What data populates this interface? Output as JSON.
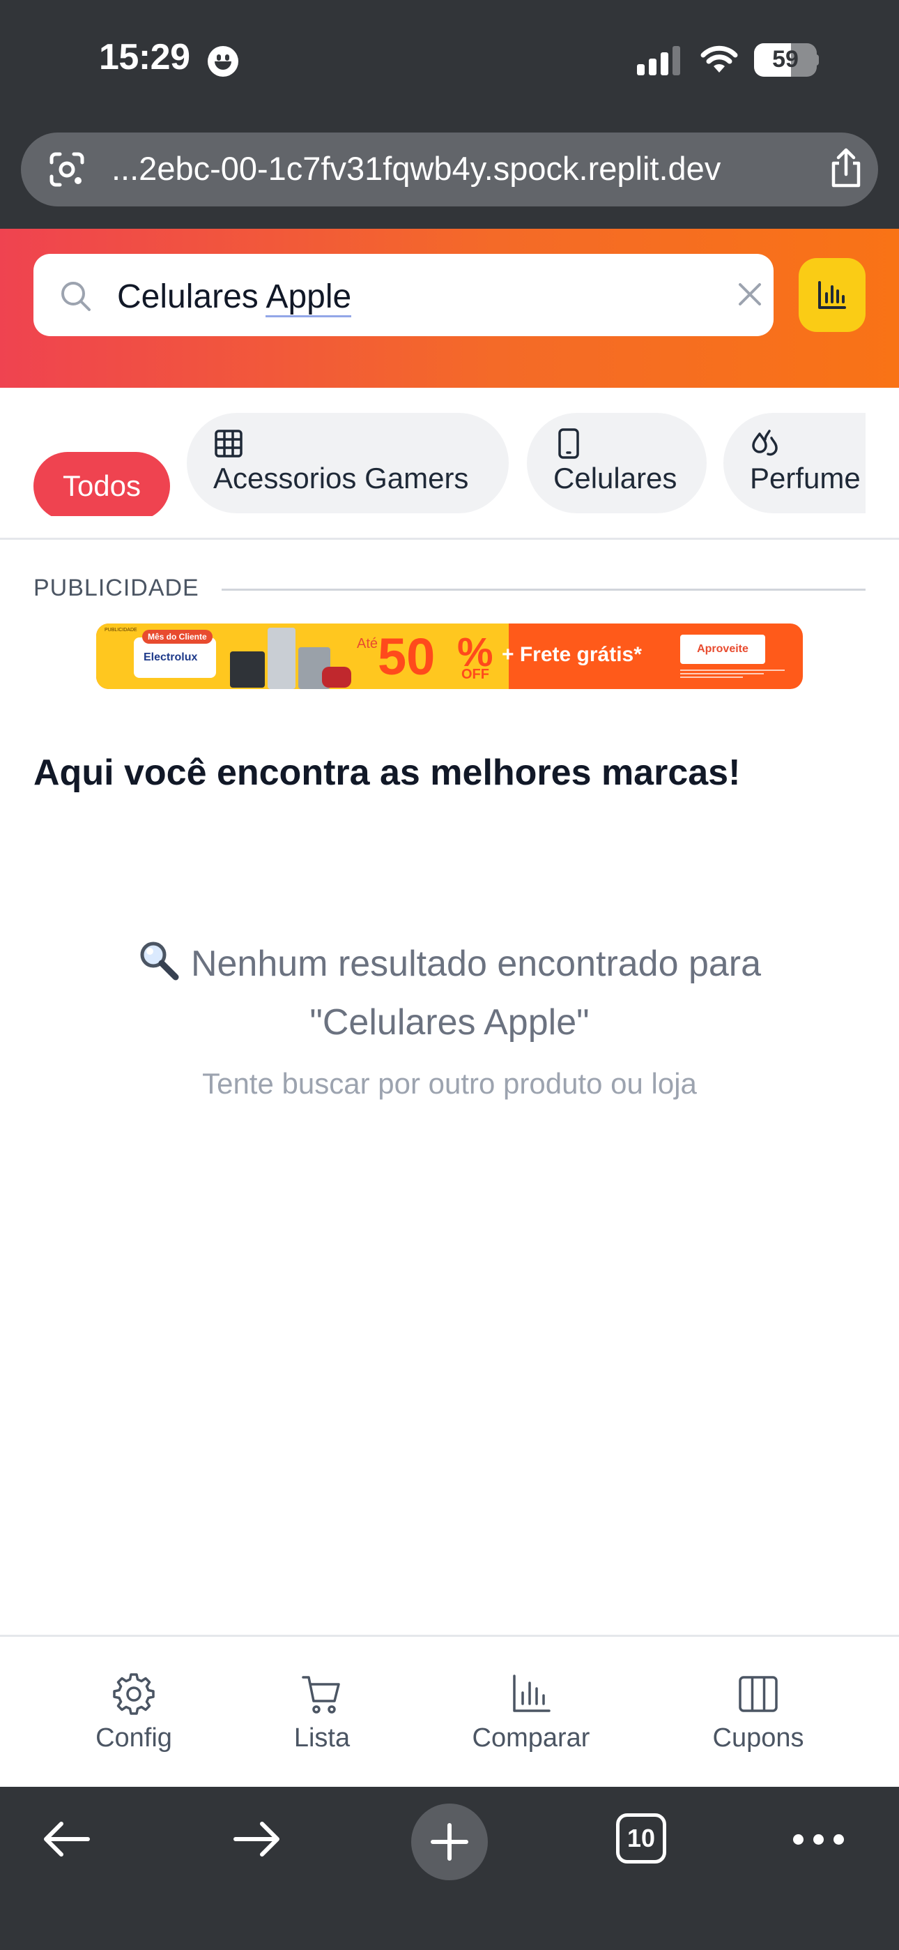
{
  "status_bar": {
    "time": "15:29",
    "battery": "59",
    "battery_level": 0.59
  },
  "browser": {
    "url": "...2ebc-00-1c7fv31fqwb4y.spock.replit.dev",
    "tabs_count": "10"
  },
  "search": {
    "value_word1": "Celulares ",
    "value_word2": "Apple"
  },
  "categories": [
    {
      "label": "Todos",
      "icon": "",
      "active": true
    },
    {
      "label": "Acessorios Gamers",
      "icon": "grid-icon",
      "active": false
    },
    {
      "label": "Celulares",
      "icon": "smartphone-icon",
      "active": false
    },
    {
      "label": "Perfume",
      "icon": "droplets-icon",
      "active": false
    }
  ],
  "ad": {
    "label": "PUBLICIDADE",
    "small_tag": "PUBLICIDADE",
    "brand_tag": "Mês do Cliente",
    "brand": "Electrolux",
    "ate": "Até",
    "discount": "50",
    "percent": "%",
    "off": "OFF",
    "frete": "+ Frete grátis*",
    "cta": "Aproveite"
  },
  "main": {
    "title": "Aqui você encontra as melhores marcas!",
    "empty_line1": "Nenhum resultado encontrado para",
    "empty_line2": "\"Celulares Apple\"",
    "empty_hint": "Tente buscar por outro produto ou loja"
  },
  "bottom_nav": [
    {
      "label": "Config",
      "icon": "gear-icon"
    },
    {
      "label": "Lista",
      "icon": "cart-icon"
    },
    {
      "label": "Comparar",
      "icon": "bar-chart-icon"
    },
    {
      "label": "Cupons",
      "icon": "columns-icon"
    }
  ],
  "colors": {
    "brand_red": "#ef4350",
    "brand_orange": "#f97316",
    "accent_yellow": "#facc15",
    "browser_chrome": "#323539"
  }
}
